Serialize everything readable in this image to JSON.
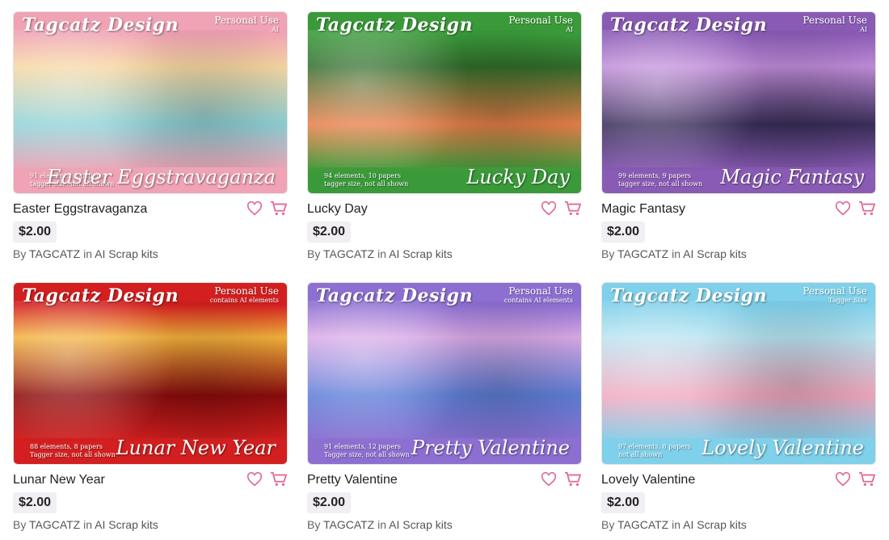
{
  "products": [
    {
      "title": "Easter Eggstravaganza",
      "price": "$2.00",
      "by": "By",
      "vendor": "TAGCATZ",
      "in": "in",
      "category": "AI Scrap kits",
      "image": {
        "brand": "Tagcatz Design",
        "badge": "Personal Use",
        "badge_sub": "AI",
        "elements": "91 elements, 8 papers",
        "note": "tagger size, not all shown",
        "script": "Easter Eggstravaganza",
        "colors": [
          "#f0a3b4",
          "#8fd3d9",
          "#f7d6a0"
        ]
      }
    },
    {
      "title": "Lucky Day",
      "price": "$2.00",
      "by": "By",
      "vendor": "TAGCATZ",
      "in": "in",
      "category": "AI Scrap kits",
      "image": {
        "brand": "Tagcatz Design",
        "badge": "Personal Use",
        "badge_sub": "AI",
        "elements": "94 elements, 10 papers",
        "note": "tagger size, not all shown",
        "script": "Lucky Day",
        "colors": [
          "#3a9a3a",
          "#e9804a",
          "#2f6b2a"
        ]
      }
    },
    {
      "title": "Magic Fantasy",
      "price": "$2.00",
      "by": "By",
      "vendor": "TAGCATZ",
      "in": "in",
      "category": "AI Scrap kits",
      "image": {
        "brand": "Tagcatz Design",
        "badge": "Personal Use",
        "badge_sub": "AI",
        "elements": "99 elements, 9 papers",
        "note": "tagger size, not all shown",
        "script": "Magic Fantasy",
        "colors": [
          "#8a5bb5",
          "#3a2f5a",
          "#c08cd9"
        ]
      }
    },
    {
      "title": "Lunar New Year",
      "price": "$2.00",
      "by": "By",
      "vendor": "TAGCATZ",
      "in": "in",
      "category": "AI Scrap kits",
      "image": {
        "brand": "Tagcatz Design",
        "badge": "Personal Use",
        "badge_sub": "contains AI elements",
        "elements": "88 elements, 8 papers",
        "note": "Tagger size, not all shown",
        "script": "Lunar New Year",
        "colors": [
          "#d31f1f",
          "#8c0d0d",
          "#f2b13a"
        ]
      }
    },
    {
      "title": "Pretty Valentine",
      "price": "$2.00",
      "by": "By",
      "vendor": "TAGCATZ",
      "in": "in",
      "category": "AI Scrap kits",
      "image": {
        "brand": "Tagcatz Design",
        "badge": "Personal Use",
        "badge_sub": "contains AI elements",
        "elements": "91 elements, 12 papers",
        "note": "Tagger size, not all shown",
        "script": "Pretty Valentine",
        "colors": [
          "#8d6fd1",
          "#5f7fd8",
          "#d9a9e6"
        ]
      }
    },
    {
      "title": "Lovely Valentine",
      "price": "$2.00",
      "by": "By",
      "vendor": "TAGCATZ",
      "in": "in",
      "category": "AI Scrap kits",
      "image": {
        "brand": "Tagcatz Design",
        "badge": "Personal Use",
        "badge_sub": "Tagger Size",
        "elements": "97 elements, 8 papers",
        "note": "not all shown",
        "script": "Lovely Valentine",
        "colors": [
          "#7fd0ea",
          "#f3a9c0",
          "#b7e3f0"
        ]
      }
    }
  ],
  "icons": {
    "heart": "heart-icon",
    "cart": "cart-icon",
    "accent": "#e26a96"
  }
}
